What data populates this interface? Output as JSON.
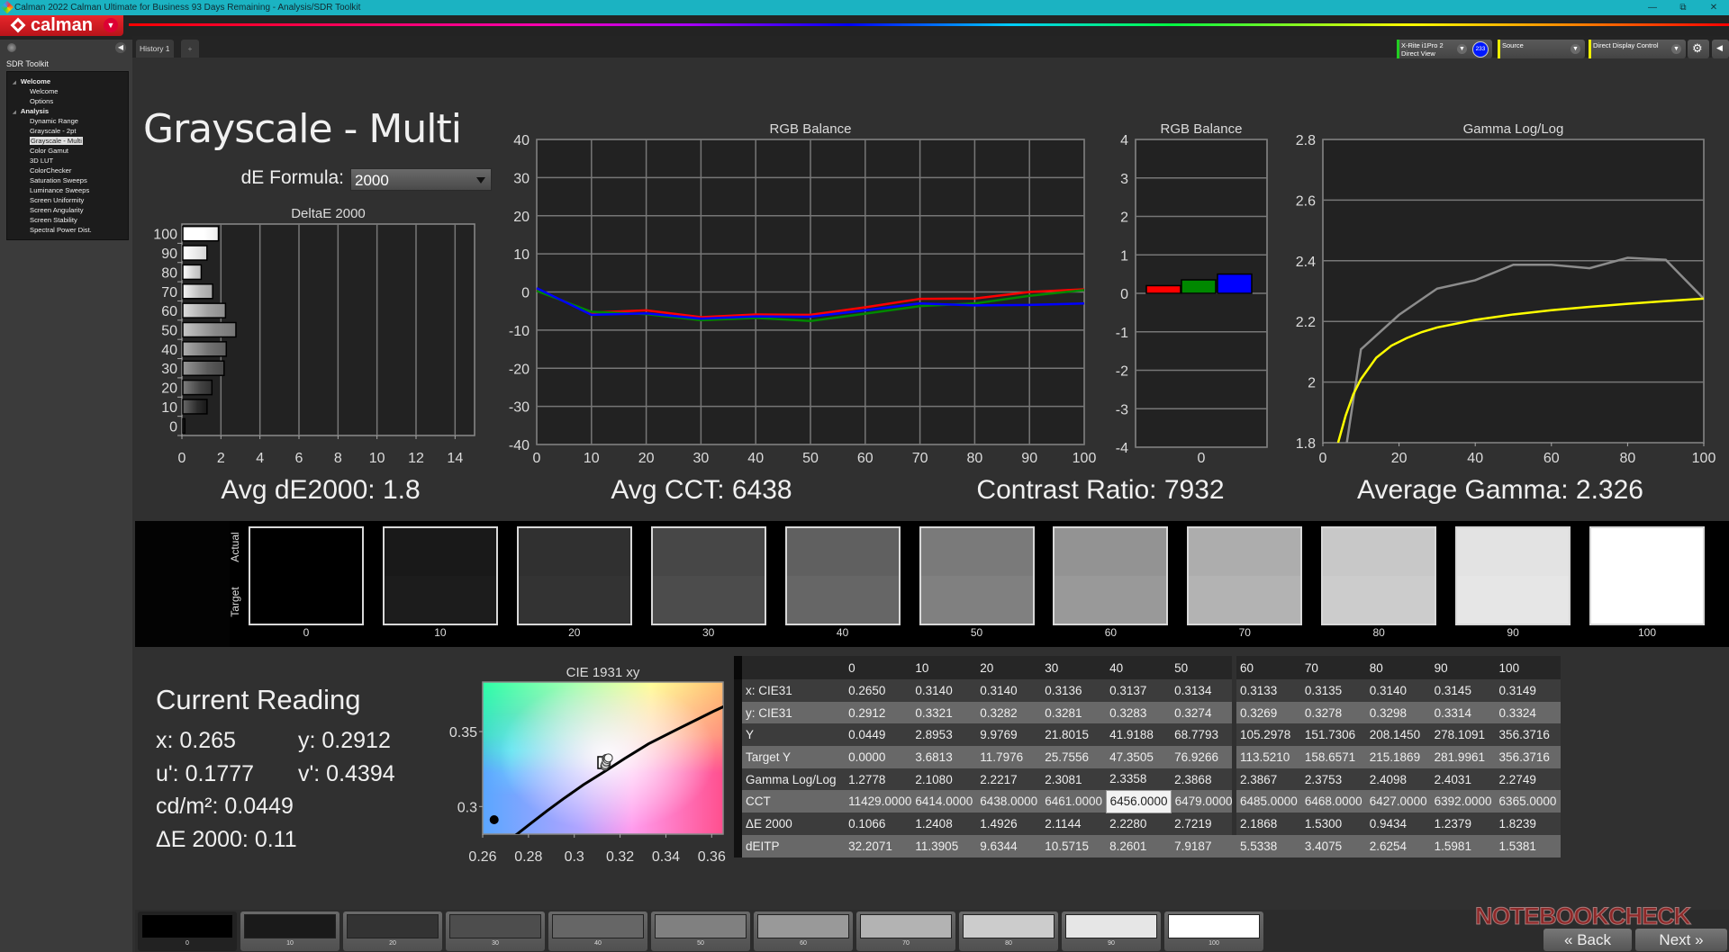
{
  "window": {
    "title": "Calman 2022 Calman Ultimate for Business 93 Days Remaining  - Analysis/SDR Toolkit"
  },
  "logo": {
    "text": "calman"
  },
  "tabs": [
    {
      "label": "History 1"
    },
    {
      "label": "+"
    }
  ],
  "toolbar": {
    "meter_line1": "X-Rite i1Pro 2",
    "meter_line2": "Direct View",
    "meter_badge": "233",
    "source": "Source",
    "display_control": "Direct Display Control",
    "meter_status_color": "#22cc22",
    "source_status_color": "#eeee00",
    "display_status_color": "#eeee00"
  },
  "sidebar": {
    "title": "SDR Toolkit",
    "items": [
      {
        "label": "Welcome",
        "level": 0
      },
      {
        "label": "Welcome",
        "level": 1
      },
      {
        "label": "Options",
        "level": 1
      },
      {
        "label": "Analysis",
        "level": 0
      },
      {
        "label": "Dynamic Range",
        "level": 1
      },
      {
        "label": "Grayscale - 2pt",
        "level": 1
      },
      {
        "label": "Grayscale - Multi",
        "level": 1,
        "selected": true
      },
      {
        "label": "Color Gamut",
        "level": 1
      },
      {
        "label": "3D LUT",
        "level": 1
      },
      {
        "label": "ColorChecker",
        "level": 1
      },
      {
        "label": "Saturation Sweeps",
        "level": 1
      },
      {
        "label": "Luminance Sweeps",
        "level": 1
      },
      {
        "label": "Screen Uniformity",
        "level": 1
      },
      {
        "label": "Screen Angularity",
        "level": 1
      },
      {
        "label": "Screen Stability",
        "level": 1
      },
      {
        "label": "Spectral Power Dist.",
        "level": 1
      }
    ]
  },
  "page": {
    "title": "Grayscale - Multi",
    "de_formula_label": "dE Formula:",
    "de_formula_value": "2000"
  },
  "stats": {
    "avg_de": "Avg dE2000: 1.8",
    "avg_cct": "Avg CCT: 6438",
    "contrast": "Contrast Ratio: 7932",
    "avg_gamma": "Average Gamma: 2.326"
  },
  "swatches": {
    "actual_label": "Actual",
    "target_label": "Target",
    "items": [
      {
        "label": "0",
        "actual": "#000000",
        "target": "#000000"
      },
      {
        "label": "10",
        "actual": "#191919",
        "target": "#1c1c1c"
      },
      {
        "label": "20",
        "actual": "#303030",
        "target": "#333333"
      },
      {
        "label": "30",
        "actual": "#474747",
        "target": "#4c4c4c"
      },
      {
        "label": "40",
        "actual": "#606060",
        "target": "#666666"
      },
      {
        "label": "50",
        "actual": "#7a7a7a",
        "target": "#808080"
      },
      {
        "label": "60",
        "actual": "#939393",
        "target": "#999999"
      },
      {
        "label": "70",
        "actual": "#adadad",
        "target": "#b3b3b3"
      },
      {
        "label": "80",
        "actual": "#c8c8c8",
        "target": "#cccccc"
      },
      {
        "label": "90",
        "actual": "#e3e3e3",
        "target": "#e6e6e6"
      },
      {
        "label": "100",
        "actual": "#ffffff",
        "target": "#ffffff"
      }
    ]
  },
  "current_reading": {
    "title": "Current Reading",
    "x": "x: 0.265",
    "y": "y: 0.2912",
    "u": "u': 0.1777",
    "v": "v': 0.4394",
    "luminance": "cd/m²: 0.0449",
    "de": "ΔE 2000: 0.11"
  },
  "table": {
    "columns": [
      "0",
      "10",
      "20",
      "30",
      "40",
      "50",
      "60",
      "70",
      "80",
      "90",
      "100"
    ],
    "rows": [
      {
        "label": "x: CIE31",
        "values": [
          "0.2650",
          "0.3140",
          "0.3140",
          "0.3136",
          "0.3137",
          "0.3134",
          "0.3133",
          "0.3135",
          "0.3140",
          "0.3145",
          "0.3149"
        ]
      },
      {
        "label": "y: CIE31",
        "values": [
          "0.2912",
          "0.3321",
          "0.3282",
          "0.3281",
          "0.3283",
          "0.3274",
          "0.3269",
          "0.3278",
          "0.3298",
          "0.3314",
          "0.3324"
        ]
      },
      {
        "label": "Y",
        "values": [
          "0.0449",
          "2.8953",
          "9.9769",
          "21.8015",
          "41.9188",
          "68.7793",
          "105.2978",
          "151.7306",
          "208.1450",
          "278.1091",
          "356.3716"
        ]
      },
      {
        "label": "Target Y",
        "values": [
          "0.0000",
          "3.6813",
          "11.7976",
          "25.7556",
          "47.3505",
          "76.9266",
          "113.5210",
          "158.6571",
          "215.1869",
          "281.9961",
          "356.3716"
        ]
      },
      {
        "label": "Gamma Log/Log",
        "values": [
          "1.2778",
          "2.1080",
          "2.2217",
          "2.3081",
          "2.3358",
          "2.3868",
          "2.3867",
          "2.3753",
          "2.4098",
          "2.4031",
          "2.2749"
        ]
      },
      {
        "label": "CCT",
        "values": [
          "11429.0000",
          "6414.0000",
          "6438.0000",
          "6461.0000",
          "6456.0000",
          "6479.0000",
          "6485.0000",
          "6468.0000",
          "6427.0000",
          "6392.0000",
          "6365.0000"
        ]
      },
      {
        "label": "ΔE 2000",
        "values": [
          "0.1066",
          "1.2408",
          "1.4926",
          "2.1144",
          "2.2280",
          "2.7219",
          "2.1868",
          "1.5300",
          "0.9434",
          "1.2379",
          "1.8239"
        ]
      },
      {
        "label": "dEITP",
        "values": [
          "32.2071",
          "11.3905",
          "9.6344",
          "10.5715",
          "8.2601",
          "7.9187",
          "5.5338",
          "3.4075",
          "2.6254",
          "1.5981",
          "1.5381"
        ]
      }
    ],
    "highlight": {
      "row": 5,
      "col": 4
    }
  },
  "patches": [
    {
      "label": "0",
      "color": "#000000"
    },
    {
      "label": "10",
      "color": "#1a1a1a"
    },
    {
      "label": "20",
      "color": "#333333"
    },
    {
      "label": "30",
      "color": "#4d4d4d"
    },
    {
      "label": "40",
      "color": "#666666"
    },
    {
      "label": "50",
      "color": "#808080"
    },
    {
      "label": "60",
      "color": "#999999"
    },
    {
      "label": "70",
      "color": "#b3b3b3"
    },
    {
      "label": "80",
      "color": "#cccccc"
    },
    {
      "label": "90",
      "color": "#e6e6e6"
    },
    {
      "label": "100",
      "color": "#ffffff"
    }
  ],
  "nav": {
    "back": "Back",
    "next": "Next"
  },
  "watermark": "NOTEBOOKCHECK",
  "chart_data": [
    {
      "type": "bar",
      "orientation": "horizontal",
      "title": "DeltaE 2000",
      "categories": [
        "0",
        "10",
        "20",
        "30",
        "40",
        "50",
        "60",
        "70",
        "80",
        "90",
        "100"
      ],
      "values": [
        0.1066,
        1.2408,
        1.4926,
        2.1144,
        2.228,
        2.7219,
        2.1868,
        1.53,
        0.9434,
        1.2379,
        1.8239
      ],
      "xlim": [
        0,
        15
      ],
      "xticks": [
        0,
        2,
        4,
        6,
        8,
        10,
        12,
        14
      ],
      "grid": true
    },
    {
      "type": "line",
      "title": "RGB Balance",
      "x": [
        0,
        10,
        20,
        30,
        40,
        50,
        60,
        70,
        80,
        90,
        100
      ],
      "series": [
        {
          "color": "#ff0000",
          "values": [
            0.5,
            -5.4,
            -4.8,
            -6.6,
            -5.9,
            -6.0,
            -4.0,
            -1.8,
            -1.7,
            0.0,
            0.7
          ]
        },
        {
          "color": "#008800",
          "values": [
            0.3,
            -5.2,
            -5.8,
            -7.4,
            -6.8,
            -7.6,
            -5.7,
            -3.7,
            -3.0,
            -1.0,
            0.5
          ]
        },
        {
          "color": "#0000ff",
          "values": [
            1.0,
            -6.0,
            -5.6,
            -7.0,
            -6.4,
            -6.5,
            -4.8,
            -3.0,
            -3.5,
            -3.4,
            -3.0
          ]
        }
      ],
      "xlim": [
        0,
        100
      ],
      "ylim": [
        -40,
        40
      ],
      "xticks": [
        0,
        10,
        20,
        30,
        40,
        50,
        60,
        70,
        80,
        90,
        100
      ],
      "yticks": [
        -40,
        -30,
        -20,
        -10,
        0,
        10,
        20,
        30,
        40
      ],
      "grid": true
    },
    {
      "type": "bar",
      "title": "RGB Balance",
      "categories": [
        "0"
      ],
      "series": [
        {
          "color": "#ff0000",
          "values": [
            0.2
          ]
        },
        {
          "color": "#008800",
          "values": [
            0.35
          ]
        },
        {
          "color": "#0000ff",
          "values": [
            0.5
          ]
        }
      ],
      "ylim": [
        -4,
        4
      ],
      "yticks": [
        -4,
        -3,
        -2,
        -1,
        0,
        1,
        2,
        3,
        4
      ],
      "grid": true
    },
    {
      "type": "line",
      "title": "Gamma Log/Log",
      "x": [
        0,
        10,
        20,
        30,
        40,
        50,
        60,
        70,
        80,
        90,
        100
      ],
      "series": [
        {
          "color": "#8c8c8c",
          "values": [
            1.2778,
            2.108,
            2.2217,
            2.3081,
            2.3358,
            2.3868,
            2.3867,
            2.3753,
            2.4098,
            2.4031,
            2.2749
          ]
        },
        {
          "color": "#ffff00",
          "x": [
            4,
            6,
            8,
            10,
            14,
            18,
            22,
            26,
            30,
            40,
            50,
            60,
            70,
            80,
            90,
            100
          ],
          "values": [
            1.8,
            1.89,
            1.96,
            2.01,
            2.08,
            2.12,
            2.145,
            2.165,
            2.18,
            2.205,
            2.223,
            2.237,
            2.248,
            2.258,
            2.267,
            2.275
          ]
        }
      ],
      "xlim": [
        0,
        100
      ],
      "ylim": [
        1.8,
        2.8
      ],
      "xticks": [
        0,
        20,
        40,
        60,
        80,
        100
      ],
      "yticks": [
        1.8,
        2,
        2.2,
        2.4,
        2.6,
        2.8
      ],
      "grid": true
    },
    {
      "type": "scatter",
      "title": "CIE 1931 xy",
      "xlim": [
        0.26,
        0.365
      ],
      "ylim": [
        0.2816,
        0.383
      ],
      "xticks": [
        0.26,
        0.28,
        0.3,
        0.32,
        0.34,
        0.36
      ],
      "xtick_labels": [
        "0.26",
        "0.28",
        "0.3",
        "0.32",
        "0.34",
        "0.36"
      ],
      "yticks": [
        0.3,
        0.35
      ],
      "ytick_labels": [
        "0.3",
        "0.35"
      ],
      "target": {
        "x": 0.3127,
        "y": 0.329
      },
      "points": [
        {
          "x": 0.314,
          "y": 0.3321
        },
        {
          "x": 0.314,
          "y": 0.3282
        },
        {
          "x": 0.3136,
          "y": 0.3281
        },
        {
          "x": 0.3137,
          "y": 0.3283
        },
        {
          "x": 0.3134,
          "y": 0.3274
        },
        {
          "x": 0.3133,
          "y": 0.3269
        },
        {
          "x": 0.3135,
          "y": 0.3278
        },
        {
          "x": 0.314,
          "y": 0.3298
        },
        {
          "x": 0.3145,
          "y": 0.3314
        },
        {
          "x": 0.3149,
          "y": 0.3324
        }
      ],
      "current": {
        "x": 0.265,
        "y": 0.2912
      },
      "planckian_locus": [
        [
          0.264,
          0.267
        ],
        [
          0.272,
          0.278
        ],
        [
          0.2807,
          0.2884
        ],
        [
          0.288,
          0.297
        ],
        [
          0.2952,
          0.3051
        ],
        [
          0.304,
          0.3145
        ],
        [
          0.3135,
          0.3236
        ],
        [
          0.322,
          0.332
        ],
        [
          0.3324,
          0.3418
        ],
        [
          0.3451,
          0.3516
        ],
        [
          0.3608,
          0.3635
        ],
        [
          0.37,
          0.37
        ]
      ]
    }
  ]
}
